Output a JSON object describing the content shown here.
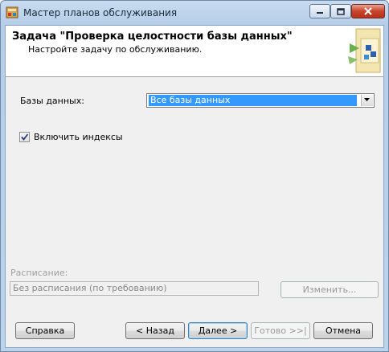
{
  "window": {
    "title": "Мастер планов обслуживания"
  },
  "header": {
    "title": "Задача \"Проверка целостности базы данных\"",
    "subtitle": "Настройте задачу по обслуживанию."
  },
  "form": {
    "databases_label": "Базы данных:",
    "databases_value": "Все базы данных",
    "include_indexes_label": "Включить индексы",
    "include_indexes_checked": true,
    "schedule_label": "Расписание:",
    "schedule_value": "Без расписания (по требованию)",
    "change_button": "Изменить..."
  },
  "buttons": {
    "help": "Справка",
    "back": "< Назад",
    "next": "Далее >",
    "finish": "Готово >>|",
    "cancel": "Отмена"
  }
}
